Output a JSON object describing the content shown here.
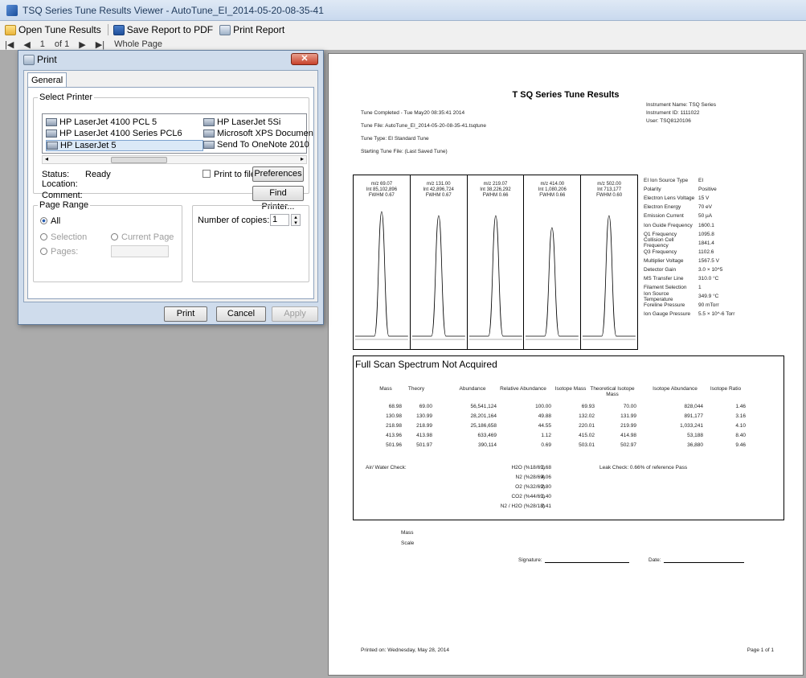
{
  "window": {
    "title": "TSQ Series Tune Results Viewer - AutoTune_EI_2014-05-20-08-35-41"
  },
  "toolbar": {
    "open": "Open Tune Results",
    "save": "Save Report to PDF",
    "print": "Print Report"
  },
  "nav": {
    "page": "1",
    "of": "of 1",
    "zoom": "Whole Page"
  },
  "report": {
    "title": "T SQ  Series Tune Results",
    "tune_completed": "Tune Completed - Tue May20 08:35:41 2014",
    "tune_file": "Tune File:  AutoTune_EI_2014-05-20-08-35-41.tsqtune",
    "tune_type": "Tune Type:   EI Standard Tune",
    "starting_tune": "Starting Tune File:     (Last Saved Tune)",
    "instrument_name": "Instrument Name:  TSQ Series",
    "instrument_id": "Instrument ID:   1111022",
    "user": "User:    TSQ8120106",
    "peaks": [
      {
        "mz": "m/z 69.07",
        "int": "Int 85,102,896",
        "fwhm": "FWHM 0.67"
      },
      {
        "mz": "m/z 131.00",
        "int": "Int 42,896,724",
        "fwhm": "FWHM 0.67"
      },
      {
        "mz": "m/z 219.07",
        "int": "Int 38,226,292",
        "fwhm": "FWHM 0.66"
      },
      {
        "mz": "m/z 414.00",
        "int": "Int 1,080,206",
        "fwhm": "FWHM 0.66"
      },
      {
        "mz": "m/z 502.00",
        "int": "Int 713,177",
        "fwhm": "FWHM 0.60"
      }
    ],
    "params": [
      {
        "name": "EI Ion Source Type",
        "value": "EI"
      },
      {
        "name": "Polarity",
        "value": "Positive"
      },
      {
        "name": "Electron Lens Voltage",
        "value": "15 V"
      },
      {
        "name": "Electron Energy",
        "value": "70 eV"
      },
      {
        "name": "Emission Current",
        "value": "50 µA"
      },
      {
        "name": "Ion Guide Frequency",
        "value": "1600.1"
      },
      {
        "name": "Q1 Frequency",
        "value": "1095.8"
      },
      {
        "name": "Collision Cell Frequency",
        "value": "1841.4"
      },
      {
        "name": "Q3 Frequency",
        "value": "1102.6"
      },
      {
        "name": "Multiplier Voltage",
        "value": "1567.5 V"
      },
      {
        "name": "Detector Gain",
        "value": "3.0 × 10^5"
      },
      {
        "name": "MS Transfer Line",
        "value": "310.0 °C"
      },
      {
        "name": "Filament Selection",
        "value": "1"
      },
      {
        "name": "Ion Source Temperature",
        "value": "349.9 °C"
      },
      {
        "name": "Foreline Pressure",
        "value": "90 mTorr"
      },
      {
        "name": "Ion Gauge Pressure",
        "value": "5.5 × 10^-6 Torr"
      }
    ],
    "scan_title": "Full Scan Spectrum Not Acquired",
    "scan_headers": [
      "Mass",
      "Theory",
      "Abundance",
      "Relative Abundance",
      "Isotope Mass",
      "Theoretical Isotope Mass",
      "Isotope Abundance",
      "Isotope Ratio"
    ],
    "scan_rows": [
      [
        "68.98",
        "69.00",
        "56,541,124",
        "100.00",
        "69.93",
        "70.00",
        "828,044",
        "1.46"
      ],
      [
        "130.98",
        "130.99",
        "28,201,164",
        "49.88",
        "132.02",
        "131.99",
        "891,177",
        "3.16"
      ],
      [
        "218.98",
        "218.99",
        "25,186,658",
        "44.55",
        "220.01",
        "219.99",
        "1,033,241",
        "4.10"
      ],
      [
        "413.96",
        "413.98",
        "633,469",
        "1.12",
        "415.02",
        "414.98",
        "53,188",
        "8.40"
      ],
      [
        "501.96",
        "501.97",
        "390,114",
        "0.69",
        "503.01",
        "502.97",
        "36,880",
        "9.46"
      ]
    ],
    "air_water_label": "Air/ Water Check:",
    "air_water": [
      {
        "label": "H2O  (%18/69)",
        "value": "1.68"
      },
      {
        "label": "N2  (%28/69)",
        "value": "4.06"
      },
      {
        "label": "O2  (%32/69)",
        "value": "2.80"
      },
      {
        "label": "CO2  (%44/69)",
        "value": "1.40"
      },
      {
        "label": "N2 / H2O  (%28/18)",
        "value": "2.41"
      }
    ],
    "leak_check": "Leak Check: 0.66% of reference Pass",
    "mass_label": "Mass",
    "scale_label": "Scale",
    "signature_label": "Signature:",
    "date_label": "Date:",
    "printed_on": "Printed on: Wednesday, May 28, 2014",
    "page_of": "Page 1 of 1"
  },
  "dialog": {
    "title": "Print",
    "tab_general": "General",
    "select_printer": "Select Printer",
    "printers": [
      "HP LaserJet 4100 PCL 5",
      "HP LaserJet 5Si",
      "HP LaserJet 4100 Series PCL6",
      "Microsoft XPS Documen",
      "HP LaserJet 5",
      "Send To OneNote 2010"
    ],
    "status_label": "Status:",
    "status_value": "Ready",
    "location_label": "Location:",
    "comment_label": "Comment:",
    "print_to_file": "Print to file",
    "preferences": "Preferences",
    "find_printer": "Find Printer...",
    "page_range": "Page Range",
    "all": "All",
    "selection": "Selection",
    "current_page": "Current Page",
    "pages": "Pages:",
    "copies_label": "Number of copies:",
    "copies_value": "1",
    "print_btn": "Print",
    "cancel_btn": "Cancel",
    "apply_btn": "Apply"
  },
  "colors": {
    "viewer_bg": "#ababab",
    "dialog_frame": "#cfdcec",
    "selected_row": "#dbe9f7"
  }
}
